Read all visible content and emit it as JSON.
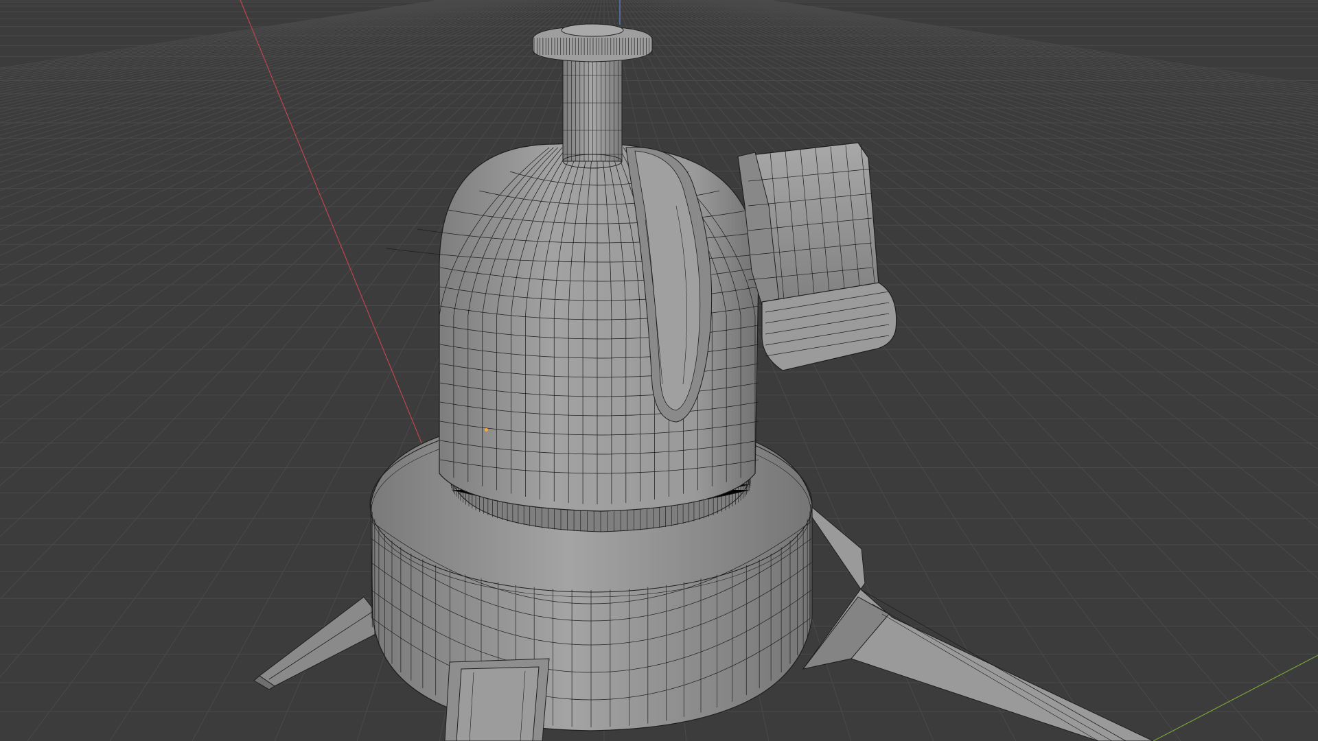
{
  "app": "3D viewport",
  "viewport": {
    "background_color": "#3c3c3c",
    "grid_color": "#4a4a4a",
    "x_axis_color": "#c0454f",
    "y_axis_color": "#7aa13a",
    "z_axis_color": "#5a86d6",
    "mesh_color": "#9b9b9b",
    "wire_color": "#1e1e1e",
    "origin_color": "#ffa53a"
  },
  "object": {
    "description_icon": "tripod-head-mesh",
    "display": "wireframe-overlay"
  }
}
